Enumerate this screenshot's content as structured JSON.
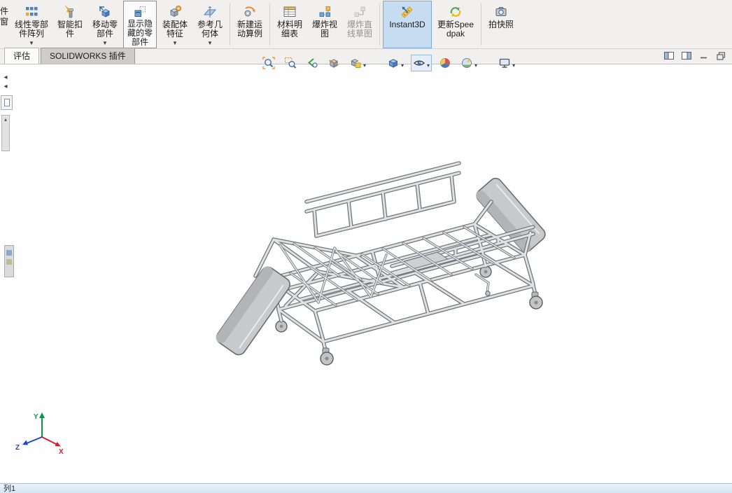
{
  "ribbon": {
    "partial_button": {
      "line1": "件",
      "line2": "窗"
    },
    "buttons": [
      {
        "label": "线性零部件阵列",
        "icon": "linear-component-pattern-icon",
        "dropdown": true
      },
      {
        "label": "智能扣件",
        "icon": "smart-fasteners-icon",
        "dropdown": false
      },
      {
        "label": "移动零部件",
        "icon": "move-component-icon",
        "dropdown": true
      },
      {
        "label": "显示隐藏的零部件",
        "icon": "show-hidden-components-icon",
        "dropdown": false
      },
      {
        "label": "装配体特征",
        "icon": "assembly-features-icon",
        "dropdown": true
      },
      {
        "label": "参考几何体",
        "icon": "reference-geometry-icon",
        "dropdown": true
      },
      {
        "label": "新建运动算例",
        "icon": "new-motion-study-icon",
        "dropdown": false
      },
      {
        "label": "材料明细表",
        "icon": "bill-of-materials-icon",
        "dropdown": false
      },
      {
        "label": "爆炸视图",
        "icon": "exploded-view-icon",
        "dropdown": false
      },
      {
        "label": "爆炸直线草图",
        "icon": "explode-line-sketch-icon",
        "dropdown": false
      },
      {
        "label": "Instant3D",
        "icon": "instant3d-icon",
        "dropdown": false
      },
      {
        "label": "更新Speedpak",
        "icon": "update-speedpak-icon",
        "dropdown": false
      },
      {
        "label": "拍快照",
        "icon": "take-snapshot-icon",
        "dropdown": false
      }
    ]
  },
  "tabs": [
    {
      "label": "评估"
    },
    {
      "label": "SOLIDWORKS 插件"
    }
  ],
  "headsup": {
    "items": [
      "zoom-to-fit",
      "zoom-to-area",
      "previous-view",
      "section-view",
      "annotation-views",
      "view-orientation",
      "hide-show-items",
      "edit-appearance",
      "apply-scene",
      "view-settings"
    ]
  },
  "window_controls": [
    "split-pane",
    "swap-pane",
    "minimize-window",
    "restore-window"
  ],
  "viewport": {
    "triad": {
      "x": "X",
      "y": "Y",
      "z": "Z"
    }
  },
  "statusbar": {
    "left_text": "列1"
  },
  "colors": {
    "active_button_bg": "#c6dcf0",
    "ribbon_bg": "#f2f0ef",
    "statusbar_bg": "#dce8f5",
    "viewport_bg": "#fefefe"
  }
}
